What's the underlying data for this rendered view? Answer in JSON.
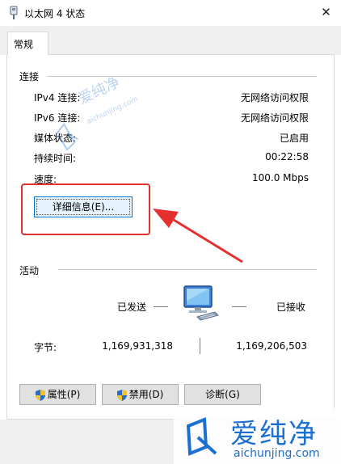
{
  "window": {
    "title": "以太网 4 状态",
    "close": "✕"
  },
  "tabs": [
    {
      "label": "常规"
    }
  ],
  "connection": {
    "group_label": "连接",
    "rows": [
      {
        "label": "IPv4 连接:",
        "value": "无网络访问权限"
      },
      {
        "label": "IPv6 连接:",
        "value": "无网络访问权限"
      },
      {
        "label": "媒体状态:",
        "value": "已启用"
      },
      {
        "label": "持续时间:",
        "value": "00:22:58"
      },
      {
        "label": "速度:",
        "value": "100.0 Mbps"
      }
    ],
    "details_button": "详细信息(E)..."
  },
  "activity": {
    "group_label": "活动",
    "sent_label": "已发送",
    "received_label": "已接收",
    "bytes_label": "字节:",
    "bytes_sent": "1,169,931,318",
    "bytes_received": "1,169,206,503"
  },
  "buttons": {
    "properties": "属性(P)",
    "disable": "禁用(D)",
    "diagnose": "诊断(G)"
  },
  "watermark": {
    "brand": "爱纯净",
    "domain": "aichunjing.com"
  },
  "colors": {
    "highlight": "#e53030",
    "focus": "#0078d7",
    "watermark": "#1a6fd1"
  },
  "icons": [
    "network-adapter-icon",
    "network-computer-icon",
    "shield-icon",
    "close-icon",
    "watermark-logo-icon"
  ]
}
